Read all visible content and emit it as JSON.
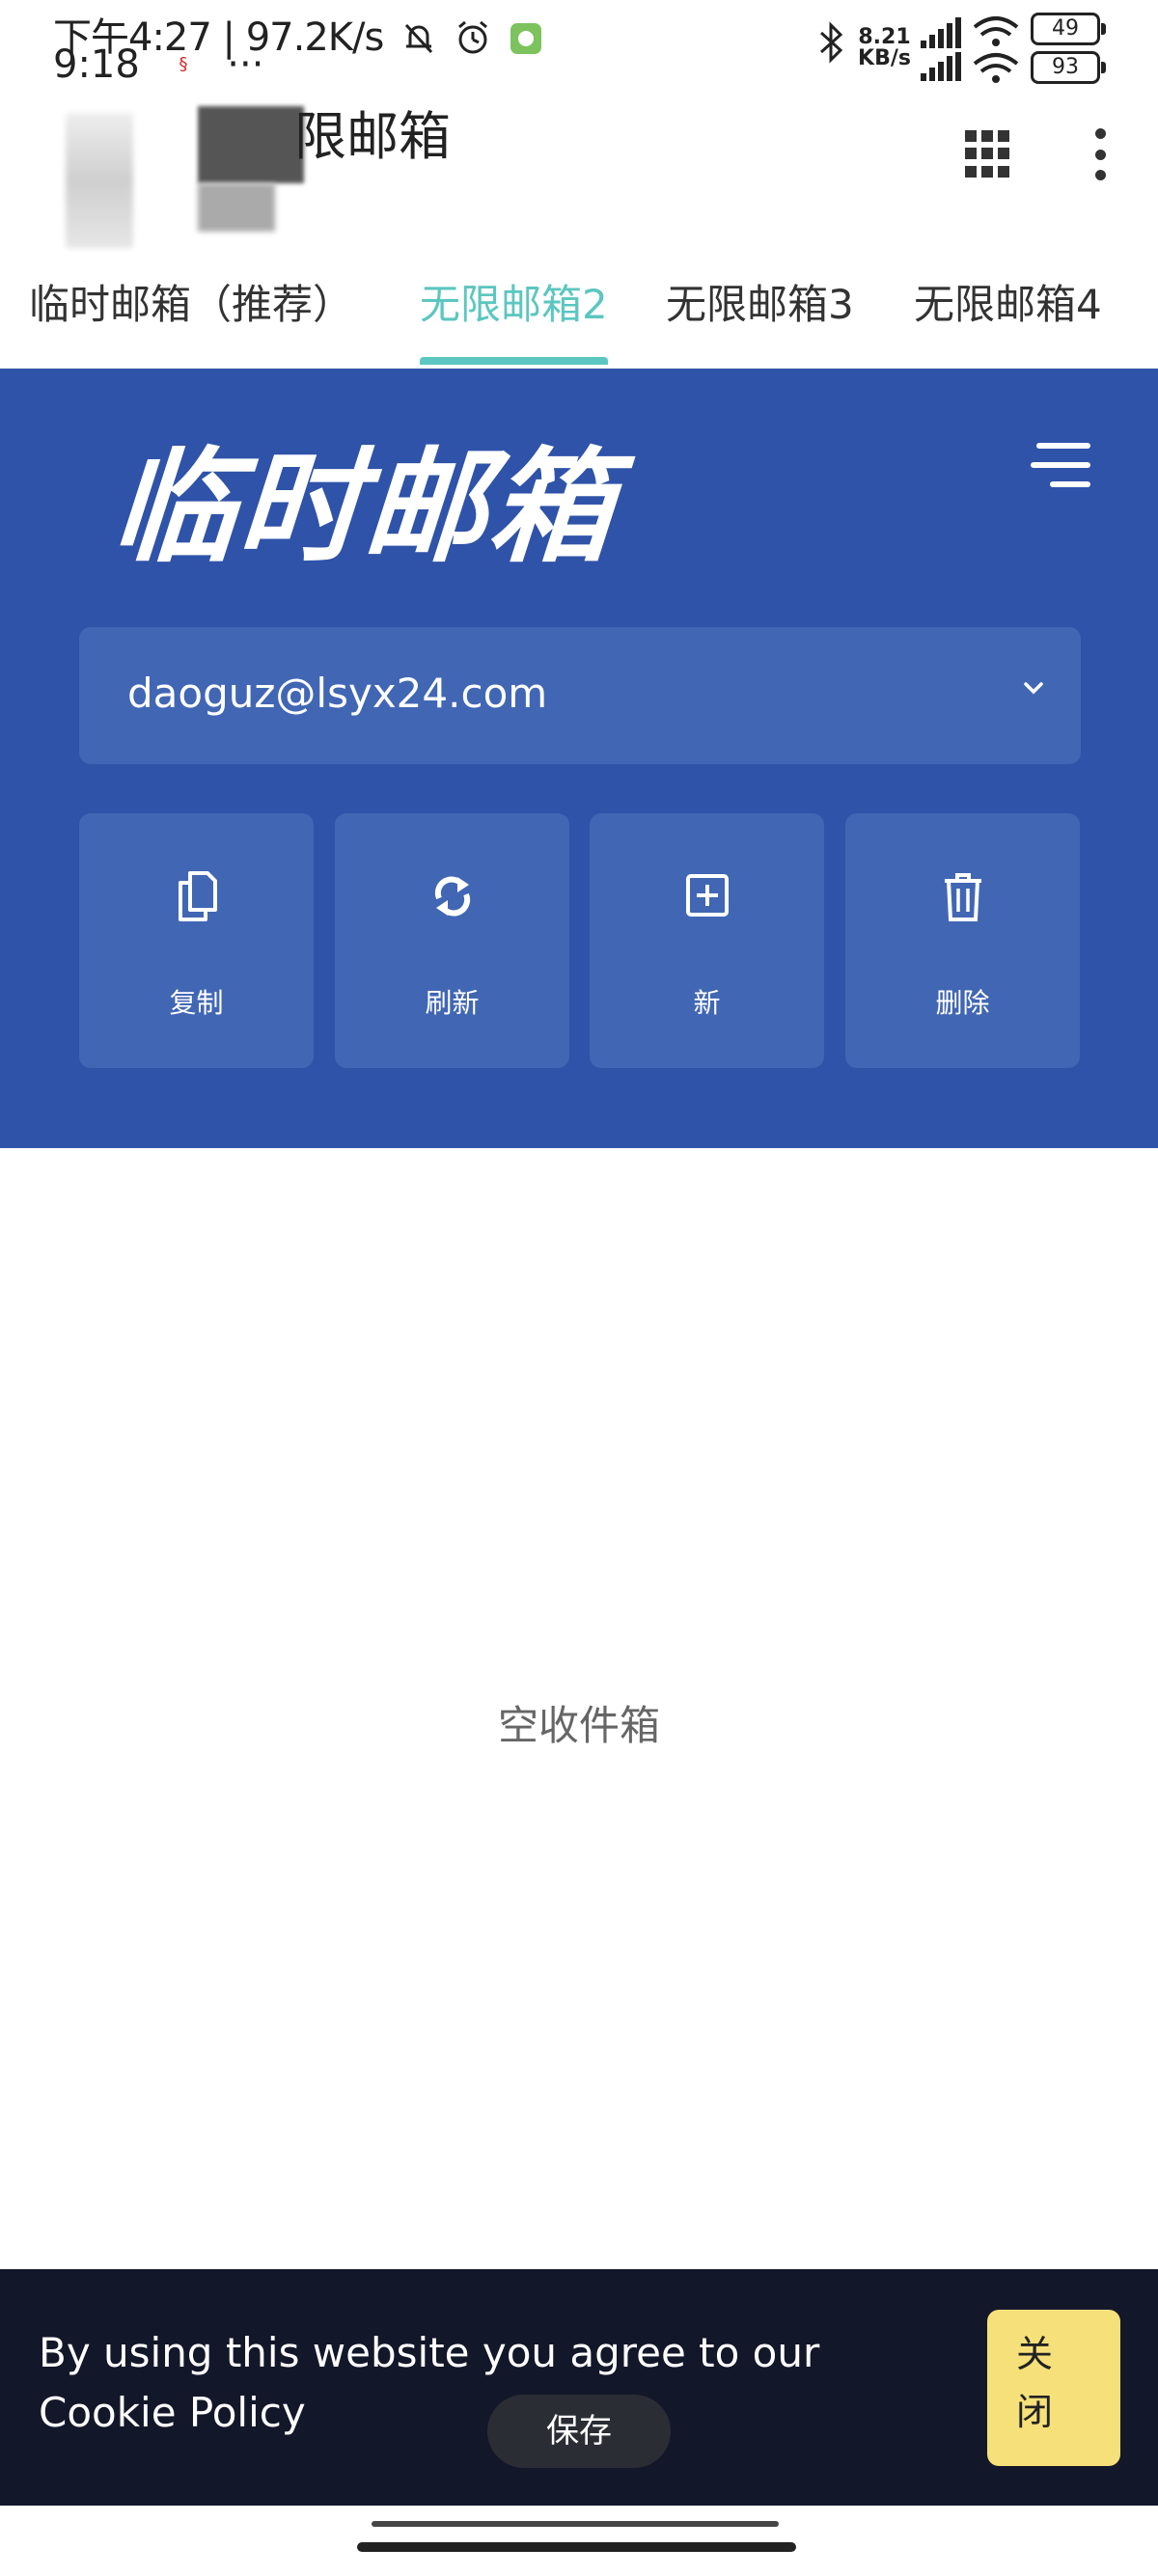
{
  "status_bar": {
    "line1": "下午4:27 | 97.2K/s",
    "time2": "9:18",
    "more": "···",
    "net_speed_value": "8.21",
    "net_speed_unit": "KB/s",
    "battery1": "49",
    "battery2": "93"
  },
  "header": {
    "title": "限邮箱"
  },
  "tabs": [
    {
      "label": "临时邮箱（推荐）"
    },
    {
      "label": "无限邮箱2"
    },
    {
      "label": "无限邮箱3"
    },
    {
      "label": "无限邮箱4"
    }
  ],
  "active_tab_index": 1,
  "panel": {
    "logo": "临时邮箱",
    "email": "daoguz@lsyx24.com",
    "actions": [
      {
        "label": "复制",
        "icon": "copy-icon"
      },
      {
        "label": "刷新",
        "icon": "refresh-icon"
      },
      {
        "label": "新",
        "icon": "add-icon"
      },
      {
        "label": "删除",
        "icon": "trash-icon"
      }
    ]
  },
  "inbox": {
    "empty_text": "空收件箱"
  },
  "cookie": {
    "text": "By using this website you agree to our Cookie Policy",
    "save_label": "保存",
    "close_label": "关闭"
  },
  "colors": {
    "accent": "#5cc6c0",
    "panel_blue": "#2f53a8",
    "card_blue": "#4166b4",
    "cookie_bg": "#13172a",
    "close_yellow": "#f6e07a"
  }
}
